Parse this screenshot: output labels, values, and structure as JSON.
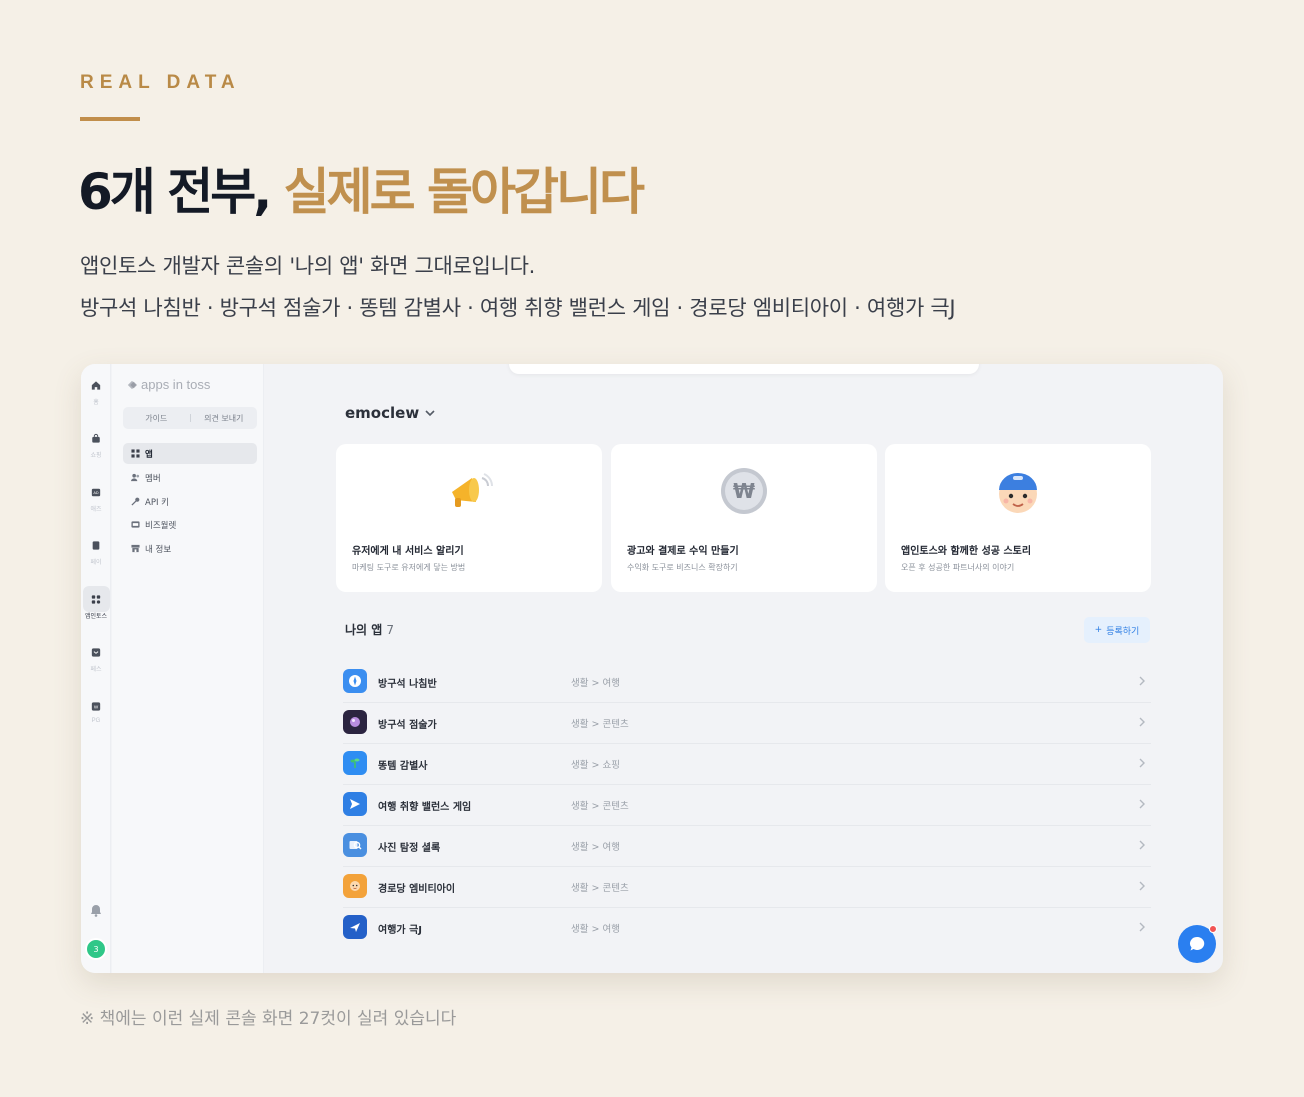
{
  "header": {
    "eyebrow": "REAL DATA",
    "title_dark": "6개 전부,",
    "title_accent": "실제로 돌아갑니다",
    "subtitle_1": "앱인토스 개발자 콘솔의 '나의 앱' 화면 그대로입니다.",
    "subtitle_2": "방구석 나침반 · 방구석 점술가 · 똥템 감별사 · 여행 취향 밸런스 게임 · 경로당 엠비티아이 · 여행가 극J"
  },
  "console": {
    "rail": [
      {
        "label": "홈",
        "icon": "home-icon"
      },
      {
        "label": "쇼핑",
        "icon": "shopping-bag-icon"
      },
      {
        "label": "애즈",
        "icon": "ads-icon"
      },
      {
        "label": "페이",
        "icon": "wallet-icon"
      },
      {
        "label": "앱인토스",
        "icon": "apps-grid-icon"
      },
      {
        "label": "페스",
        "icon": "pass-icon"
      },
      {
        "label": "PG",
        "icon": "pg-icon"
      }
    ],
    "logo_text": "apps in toss",
    "side_buttons": {
      "guide": "가이드",
      "feedback": "의견 보내기"
    },
    "nav": [
      {
        "label": "앱",
        "icon": "grid-icon"
      },
      {
        "label": "멤버",
        "icon": "members-icon"
      },
      {
        "label": "API 키",
        "icon": "key-icon"
      },
      {
        "label": "비즈월렛",
        "icon": "wallet-card-icon"
      },
      {
        "label": "내 정보",
        "icon": "store-icon"
      }
    ],
    "account": "emoclew",
    "cards": [
      {
        "title": "유저에게 내 서비스 알리기",
        "desc": "마케팅 도구로 유저에게 닿는 방법"
      },
      {
        "title": "광고와 결제로 수익 만들기",
        "desc": "수익화 도구로 비즈니스 확장하기"
      },
      {
        "title": "앱인토스와 함께한 성공 스토리",
        "desc": "오픈 후 성공한 파트너사의 이야기"
      }
    ],
    "my_apps": {
      "label": "나의 앱",
      "count": "7",
      "register": "등록하기"
    },
    "apps": [
      {
        "name": "방구석 나침반",
        "category": "생활 > 여행",
        "color": "#3b8ef0"
      },
      {
        "name": "방구석 점술가",
        "category": "생활 > 콘텐츠",
        "color": "#2b2440"
      },
      {
        "name": "똥템 감별사",
        "category": "생활 > 쇼핑",
        "color": "#2f8df2"
      },
      {
        "name": "여행 취향 밸런스 게임",
        "category": "생활 > 콘텐츠",
        "color": "#2f7fe4"
      },
      {
        "name": "사진 탐정 셜록",
        "category": "생활 > 여행",
        "color": "#4a8fe0"
      },
      {
        "name": "경로당 엠비티아이",
        "category": "생활 > 콘텐츠",
        "color": "#f3a23a"
      },
      {
        "name": "여행가 극J",
        "category": "생활 > 여행",
        "color": "#2460c8"
      }
    ],
    "avatar_text": "3"
  },
  "footnote": "※ 책에는 이런 실제 콘솔 화면 27컷이 실려 있습니다",
  "colors": {
    "background": "#f5f0e7",
    "accent": "#c0904e",
    "title": "#141a26",
    "toss_blue": "#2f7fe4"
  }
}
